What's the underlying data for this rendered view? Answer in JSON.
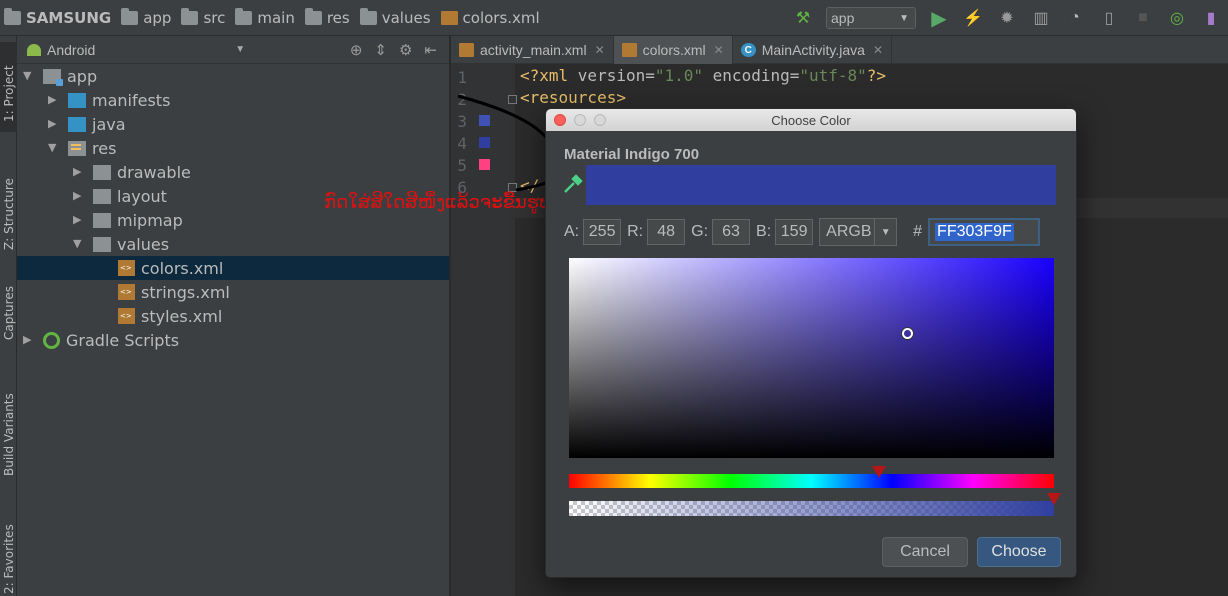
{
  "breadcrumbs": [
    "SAMSUNG",
    "app",
    "src",
    "main",
    "res",
    "values",
    "colors.xml"
  ],
  "run_config": "app",
  "left_tabs": [
    "1: Project",
    "Z: Structure",
    "Captures",
    "Build Variants",
    "2: Favorites"
  ],
  "project_panel": {
    "view_mode": "Android",
    "tree": [
      {
        "label": "app",
        "depth": 0,
        "expanded": true,
        "icon": "module-icon"
      },
      {
        "label": "manifests",
        "depth": 1,
        "expanded": false,
        "icon": "folder-blue-icon"
      },
      {
        "label": "java",
        "depth": 1,
        "expanded": false,
        "icon": "folder-blue-icon"
      },
      {
        "label": "res",
        "depth": 1,
        "expanded": true,
        "icon": "res-folder-icon"
      },
      {
        "label": "drawable",
        "depth": 2,
        "expanded": false,
        "icon": "folder-icon"
      },
      {
        "label": "layout",
        "depth": 2,
        "expanded": false,
        "icon": "folder-icon"
      },
      {
        "label": "mipmap",
        "depth": 2,
        "expanded": false,
        "icon": "folder-icon"
      },
      {
        "label": "values",
        "depth": 2,
        "expanded": true,
        "icon": "folder-icon"
      },
      {
        "label": "colors.xml",
        "depth": 3,
        "selected": true,
        "icon": "xml-file-icon"
      },
      {
        "label": "strings.xml",
        "depth": 3,
        "icon": "xml-file-icon"
      },
      {
        "label": "styles.xml",
        "depth": 3,
        "icon": "xml-file-icon"
      },
      {
        "label": "Gradle Scripts",
        "depth": 0,
        "expanded": false,
        "icon": "gradle-icon"
      }
    ]
  },
  "editor": {
    "tabs": [
      {
        "label": "activity_main.xml",
        "active": false
      },
      {
        "label": "colors.xml",
        "active": true
      },
      {
        "label": "MainActivity.java",
        "active": false
      }
    ],
    "line_numbers": [
      "1",
      "2",
      "3",
      "4",
      "5",
      "6"
    ],
    "line1": {
      "open": "<?xml ",
      "version_attr": "version=",
      "version_val": "\"1.0\"",
      "encoding_attr": " encoding=",
      "encoding_val": "\"utf-8\"",
      "close": "?>"
    },
    "line2": "<resources>",
    "line6": "</",
    "swatch_colors": [
      "#3f51b5",
      "#303f9f",
      "#ff4081"
    ]
  },
  "annotation": "ກົດໃສ່ສີໃດສີໜຶ່ງແລ້ວຈະຂື້ນຮູບສີມາໃຫ້ເລືອກ",
  "color_dialog": {
    "title": "Choose Color",
    "color_name": "Material Indigo 700",
    "preview_color": "#303f9f",
    "a_label": "A:",
    "a_value": "255",
    "r_label": "R:",
    "r_value": "48",
    "g_label": "G:",
    "g_value": "63",
    "b_label": "B:",
    "b_value": "159",
    "mode": "ARGB",
    "hash": "#",
    "hex": "FF303F9F",
    "hue_position": 0.64,
    "alpha_position": 1.0,
    "cancel_label": "Cancel",
    "choose_label": "Choose"
  }
}
